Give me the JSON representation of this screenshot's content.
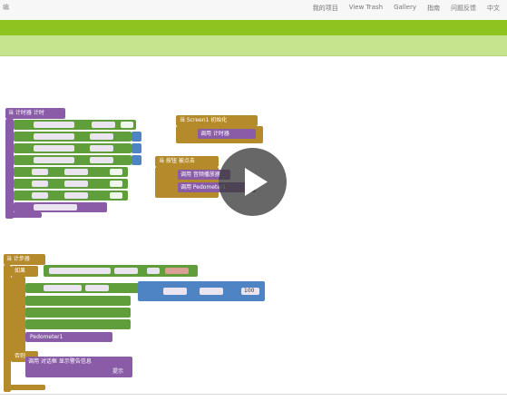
{
  "window": {
    "title_fragment": "编"
  },
  "top_nav": [
    "我的项目",
    "View Trash",
    "Gallery",
    "指南",
    "问题反馈",
    "中文"
  ],
  "blocks": {
    "b1_header": "当 计时器 计时",
    "b2_header": "当 Screen1 初始化",
    "b2_call": "调用 计时器",
    "b3_header": "当 按钮 被点击",
    "b3_call1": "调用 音频播放器",
    "b3_call2": "调用 Pedometer1",
    "b4_header": "当 计步器",
    "b4_if": "如果",
    "b4_else": "否则",
    "b4_num": "100",
    "b4_pedo": "Pedometer1",
    "b4_notice": "调用 对话框 显示警告信息",
    "b4_notice_tail": "提示"
  },
  "video": {
    "control": "play-button"
  },
  "colors": {
    "green_bar": "#8fc31f",
    "light_bar": "#c5e48d",
    "block_purple": "#8a5ca8",
    "block_gold": "#b58a2a",
    "block_green": "#5f9e3a",
    "block_blue": "#4f84c4"
  }
}
